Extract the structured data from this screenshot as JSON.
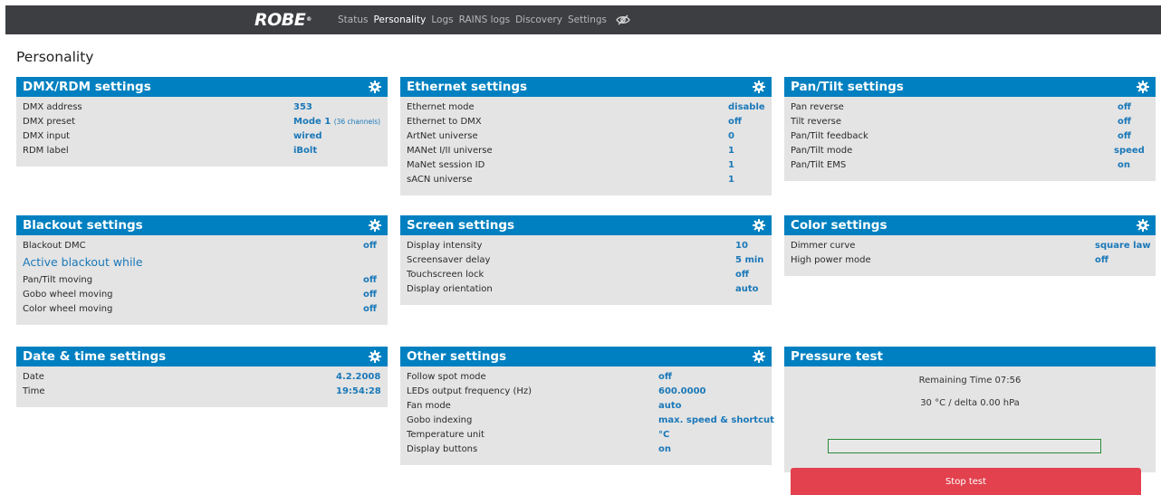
{
  "brand": "ROBE",
  "nav": [
    "Status",
    "Personality",
    "Logs",
    "RAINS logs",
    "Discovery",
    "Settings"
  ],
  "page_title": "Personality",
  "dmx": {
    "title": "DMX/RDM settings",
    "rows": [
      {
        "label": "DMX address",
        "value": "353",
        "note": ""
      },
      {
        "label": "DMX preset",
        "value": "Mode 1",
        "note": "(36 channels)"
      },
      {
        "label": "DMX input",
        "value": "wired",
        "note": ""
      },
      {
        "label": "RDM label",
        "value": "iBolt",
        "note": ""
      }
    ]
  },
  "ethernet": {
    "title": "Ethernet settings",
    "rows": [
      {
        "label": "Ethernet mode",
        "value": "disable"
      },
      {
        "label": "Ethernet to DMX",
        "value": "off"
      },
      {
        "label": "ArtNet universe",
        "value": "0"
      },
      {
        "label": "MANet I/II universe",
        "value": "1"
      },
      {
        "label": "MaNet session ID",
        "value": "1"
      },
      {
        "label": "sACN universe",
        "value": "1"
      }
    ]
  },
  "pantilt": {
    "title": "Pan/Tilt settings",
    "rows": [
      {
        "label": "Pan reverse",
        "value": "off"
      },
      {
        "label": "Tilt reverse",
        "value": "off"
      },
      {
        "label": "Pan/Tilt feedback",
        "value": "off"
      },
      {
        "label": "Pan/Tilt mode",
        "value": "speed"
      },
      {
        "label": "Pan/Tilt EMS",
        "value": "on"
      }
    ]
  },
  "blackout": {
    "title": "Blackout settings",
    "dmc_label": "Blackout DMC",
    "dmc_value": "off",
    "subheading": "Active blackout while",
    "rows": [
      {
        "label": "Pan/Tilt moving",
        "value": "off"
      },
      {
        "label": "Gobo wheel moving",
        "value": "off"
      },
      {
        "label": "Color wheel moving",
        "value": "off"
      }
    ]
  },
  "screen": {
    "title": "Screen settings",
    "rows": [
      {
        "label": "Display intensity",
        "value": "10"
      },
      {
        "label": "Screensaver delay",
        "value": "5 min"
      },
      {
        "label": "Touchscreen lock",
        "value": "off"
      },
      {
        "label": "Display orientation",
        "value": "auto"
      }
    ]
  },
  "color": {
    "title": "Color settings",
    "rows": [
      {
        "label": "Dimmer curve",
        "value": "square law"
      },
      {
        "label": "High power mode",
        "value": "off"
      }
    ]
  },
  "datetime": {
    "title": "Date & time settings",
    "rows": [
      {
        "label": "Date",
        "value": "4.2.2008"
      },
      {
        "label": "Time",
        "value": "19:54:28"
      }
    ]
  },
  "other": {
    "title": "Other settings",
    "rows": [
      {
        "label": "Follow spot mode",
        "value": "off"
      },
      {
        "label": "LEDs output frequency (Hz)",
        "value": "600.0000"
      },
      {
        "label": "Fan mode",
        "value": "auto"
      },
      {
        "label": "Gobo indexing",
        "value": "max. speed & shortcut"
      },
      {
        "label": "Temperature unit",
        "value": "°C"
      },
      {
        "label": "Display buttons",
        "value": "on"
      }
    ]
  },
  "pressure": {
    "title": "Pressure test",
    "remaining": "Remaining Time 07:56",
    "reading": "30 °C / delta 0.00 hPa",
    "progress": 0,
    "stop_label": "Stop test"
  }
}
